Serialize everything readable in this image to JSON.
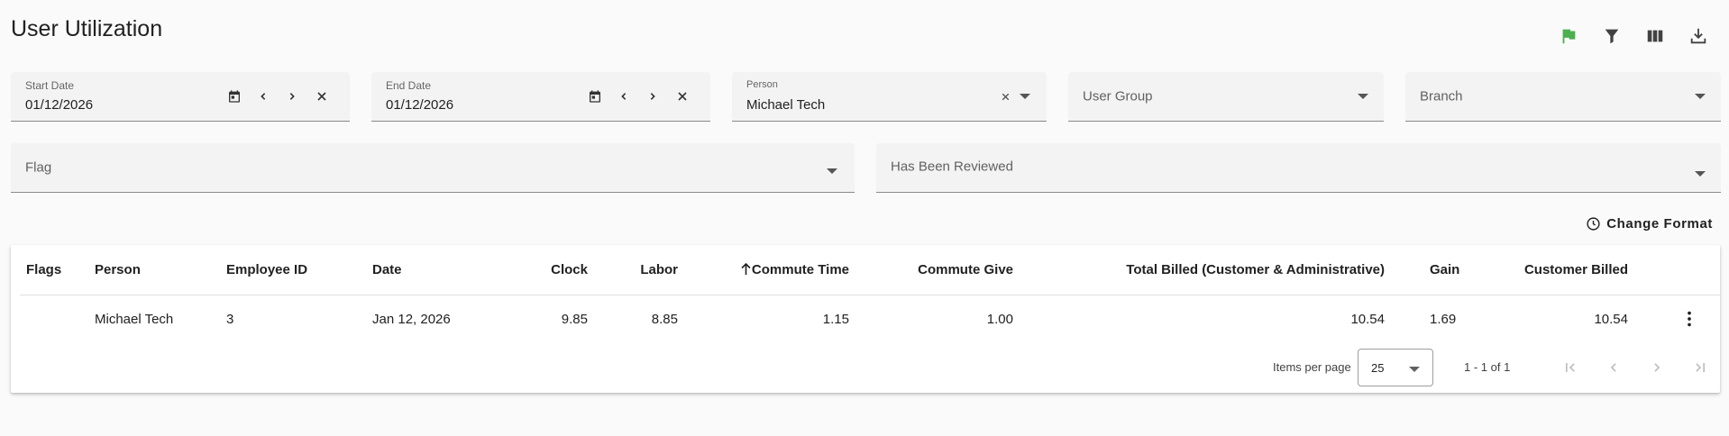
{
  "page": {
    "title": "User Utilization"
  },
  "toolbar": {
    "icons": [
      "flag-icon",
      "filter-icon",
      "columns-icon",
      "download-icon"
    ],
    "flag_color": "#4caf50"
  },
  "filters": {
    "start_date": {
      "label": "Start Date",
      "value": "01/12/2026"
    },
    "end_date": {
      "label": "End Date",
      "value": "01/12/2026"
    },
    "person": {
      "label": "Person",
      "value": "Michael Tech"
    },
    "user_group": {
      "placeholder": "User Group"
    },
    "branch": {
      "placeholder": "Branch"
    },
    "flag": {
      "placeholder": "Flag"
    },
    "has_been_reviewed": {
      "placeholder": "Has Been Reviewed"
    }
  },
  "change_format": {
    "label": "Change Format"
  },
  "table": {
    "columns": [
      "Flags",
      "Person",
      "Employee ID",
      "Date",
      "Clock",
      "Labor",
      "Commute Time",
      "Commute Give",
      "Total Billed (Customer & Administrative)",
      "Gain",
      "Customer Billed"
    ],
    "sorted_column": "Commute Time",
    "rows": [
      {
        "flags": "",
        "person": "Michael Tech",
        "employee_id": "3",
        "date": "Jan 12, 2026",
        "clock": "9.85",
        "labor": "8.85",
        "commute_time": "1.15",
        "commute_give": "1.00",
        "total_billed": "10.54",
        "gain": "1.69",
        "customer_billed": "10.54"
      }
    ]
  },
  "paginator": {
    "items_per_page_label": "Items per page",
    "page_size": "25",
    "range": "1 - 1 of 1"
  }
}
